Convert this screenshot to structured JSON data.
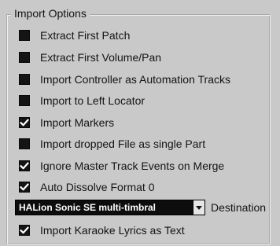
{
  "group": {
    "title": "Import Options"
  },
  "options": [
    {
      "label": "Extract First Patch",
      "checked": false
    },
    {
      "label": "Extract First Volume/Pan",
      "checked": false
    },
    {
      "label": "Import Controller as Automation Tracks",
      "checked": false
    },
    {
      "label": "Import to Left Locator",
      "checked": false
    },
    {
      "label": "Import Markers",
      "checked": true
    },
    {
      "label": "Import dropped File as single Part",
      "checked": false
    },
    {
      "label": "Ignore Master Track Events on Merge",
      "checked": true
    },
    {
      "label": "Auto Dissolve Format 0",
      "checked": true
    }
  ],
  "destination": {
    "value": "HALion Sonic SE multi-timbral",
    "label": "Destination"
  },
  "karaoke": {
    "label": "Import Karaoke Lyrics as Text",
    "checked": true
  },
  "colors": {
    "background": "#c9c9c9",
    "checkbox": "#141414",
    "check_mark": "#ffffff",
    "select_background": "#0d0d0d"
  }
}
